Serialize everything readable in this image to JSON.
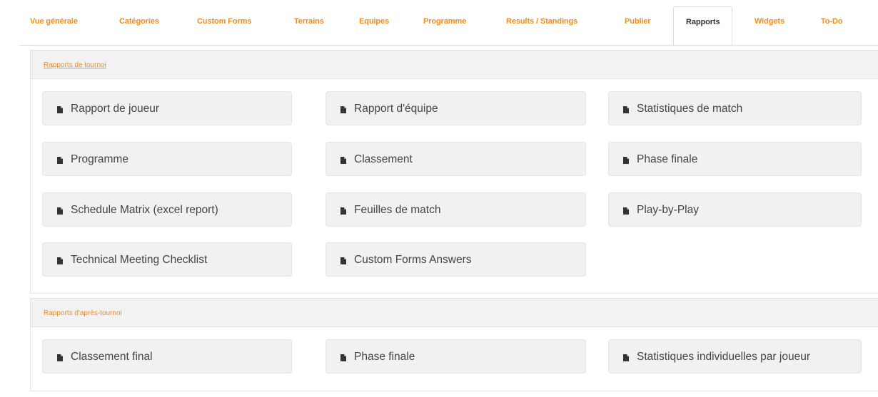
{
  "tabs": [
    {
      "label": "Vue générale"
    },
    {
      "label": "Catégories"
    },
    {
      "label": "Custom Forms"
    },
    {
      "label": "Terrains"
    },
    {
      "label": "Equipes"
    },
    {
      "label": "Programme"
    },
    {
      "label": "Results / Standings"
    },
    {
      "label": "Publier"
    },
    {
      "label": "Rapports",
      "active": true
    },
    {
      "label": "Widgets"
    },
    {
      "label": "To-Do"
    }
  ],
  "panels": {
    "tournament": {
      "title": "Rapports de tournoi",
      "items": [
        {
          "label": "Rapport de joueur",
          "icon": "document-icon"
        },
        {
          "label": "Rapport d'équipe",
          "icon": "document-icon"
        },
        {
          "label": "Statistiques de match",
          "icon": "document-icon"
        },
        {
          "label": "Programme",
          "icon": "document-icon"
        },
        {
          "label": "Classement",
          "icon": "document-icon"
        },
        {
          "label": "Phase finale",
          "icon": "document-icon"
        },
        {
          "label": "Schedule Matrix (excel report)",
          "icon": "document-icon"
        },
        {
          "label": "Feuilles de match",
          "icon": "document-icon"
        },
        {
          "label": "Play-by-Play",
          "icon": "document-icon"
        },
        {
          "label": "Technical Meeting Checklist",
          "icon": "document-icon"
        },
        {
          "label": "Custom Forms Answers",
          "icon": "document-icon"
        }
      ]
    },
    "post": {
      "title": "Rapports d'après-tournoi",
      "items": [
        {
          "label": "Classement final",
          "icon": "document-icon"
        },
        {
          "label": "Phase finale",
          "icon": "document-icon"
        },
        {
          "label": "Statistiques individuelles par joueur",
          "icon": "document-icon"
        }
      ]
    }
  },
  "colors": {
    "accent": "#f28c1b",
    "button_bg": "#f1f1f1",
    "header_bg": "#f2f2f2"
  }
}
